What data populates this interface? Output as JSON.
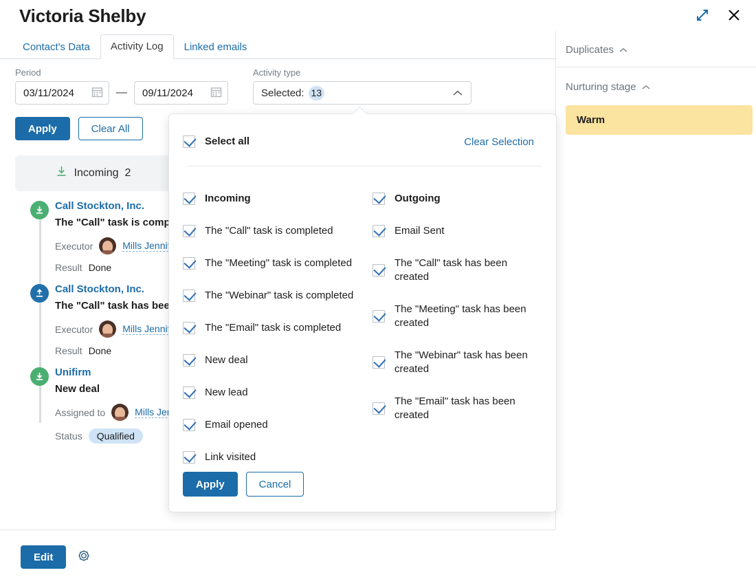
{
  "header": {
    "title": "Victoria Shelby",
    "expand_icon": "expand-arrows-icon",
    "close_icon": "close-x-icon"
  },
  "tabs": [
    {
      "label": "Contact's Data",
      "active": false
    },
    {
      "label": "Activity Log",
      "active": true
    },
    {
      "label": "Linked emails",
      "active": false
    }
  ],
  "filters": {
    "period_label": "Period",
    "date_from": "03/11/2024",
    "date_to": "09/11/2024",
    "date_separator": "—",
    "calendar_icon": "calendar-icon",
    "activity_type_label": "Activity type",
    "activity_type_value": "Selected:",
    "activity_type_count": "13",
    "chevron_icon": "chevron-up-icon",
    "apply_label": "Apply",
    "clear_all_label": "Clear All"
  },
  "timeline": {
    "group_label": "Incoming",
    "group_count": "2",
    "group_icon": "download-icon",
    "items": [
      {
        "direction": "incoming",
        "icon": "download-circle-icon",
        "company": "Call Stockton, Inc.",
        "subject": "The \"Call\" task is completed",
        "meta_label": "Executor",
        "person": "Mills Jennifer",
        "avatar": "user-avatar",
        "result_label": "Result",
        "result_value": "Done",
        "result_is_pill": false
      },
      {
        "direction": "outgoing",
        "icon": "upload-circle-icon",
        "company": "Call Stockton, Inc.",
        "subject": "The \"Call\" task has been created",
        "meta_label": "Executor",
        "person": "Mills Jennifer",
        "avatar": "user-avatar",
        "result_label": "Result",
        "result_value": "Done",
        "result_is_pill": false
      },
      {
        "direction": "incoming",
        "icon": "download-circle-icon",
        "company": "Unifirm",
        "subject": "New deal",
        "meta_label": "Assigned to",
        "person": "Mills Jennifer",
        "avatar": "user-avatar",
        "result_label": "Status",
        "result_value": "Qualified",
        "result_is_pill": true
      }
    ]
  },
  "sidebar": {
    "duplicates": {
      "label": "Duplicates",
      "chevron": "chevron-up-icon"
    },
    "nurturing": {
      "label": "Nurturing stage",
      "chevron": "chevron-up-icon",
      "value": "Warm",
      "value_color": "#fbe3a0"
    }
  },
  "bottom": {
    "edit_label": "Edit",
    "settings_icon": "gear-icon"
  },
  "dropdown": {
    "select_all_label": "Select all",
    "clear_selection_label": "Clear Selection",
    "left_column": [
      {
        "label": "Incoming",
        "checked": true,
        "bold": true
      },
      {
        "label": "The \"Call\" task is completed",
        "checked": true,
        "bold": false
      },
      {
        "label": "The \"Meeting\" task is completed",
        "checked": true,
        "bold": false
      },
      {
        "label": "The \"Webinar\" task is completed",
        "checked": true,
        "bold": false
      },
      {
        "label": "The \"Email\" task is completed",
        "checked": true,
        "bold": false
      },
      {
        "label": "New deal",
        "checked": true,
        "bold": false
      },
      {
        "label": "New lead",
        "checked": true,
        "bold": false
      },
      {
        "label": "Email opened",
        "checked": true,
        "bold": false
      },
      {
        "label": "Link visited",
        "checked": true,
        "bold": false
      }
    ],
    "right_column": [
      {
        "label": "Outgoing",
        "checked": true,
        "bold": true
      },
      {
        "label": "Email Sent",
        "checked": true,
        "bold": false
      },
      {
        "label": "The \"Call\" task has been created",
        "checked": true,
        "bold": false
      },
      {
        "label": "The \"Meeting\" task has been created",
        "checked": true,
        "bold": false
      },
      {
        "label": "The \"Webinar\" task has been created",
        "checked": true,
        "bold": false
      },
      {
        "label": "The \"Email\" task has been created",
        "checked": true,
        "bold": false
      }
    ],
    "apply_label": "Apply",
    "cancel_label": "Cancel"
  },
  "colors": {
    "accent_blue": "#1b6ca8",
    "incoming_green": "#4caf72",
    "outgoing_blue": "#2270aa",
    "warm_yellow": "#fbe3a0",
    "badge_blue": "#cfe3f5"
  }
}
